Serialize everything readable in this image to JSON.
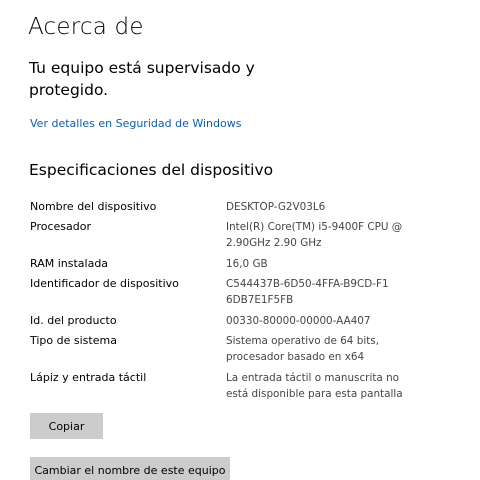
{
  "page": {
    "title": "Acerca de",
    "status": "Tu equipo está supervisado y protegido.",
    "security_link": "Ver detalles en Seguridad de Windows"
  },
  "specs": {
    "section_title": "Especificaciones del dispositivo",
    "rows": [
      {
        "label": "Nombre del dispositivo",
        "value": "DESKTOP-G2V03L6"
      },
      {
        "label": "Procesador",
        "value": "Intel(R) Core(TM) i5-9400F CPU @ 2.90GHz   2.90 GHz"
      },
      {
        "label": "RAM instalada",
        "value": "16,0 GB"
      },
      {
        "label": "Identificador de dispositivo",
        "value": "C544437B-6D50-4FFA-B9CD-F16DB7E1F5FB"
      },
      {
        "label": "Id. del producto",
        "value": "00330-80000-00000-AA407"
      },
      {
        "label": "Tipo de sistema",
        "value": "Sistema operativo de 64 bits, procesador basado en x64"
      },
      {
        "label": "Lápiz y entrada táctil",
        "value": "La entrada táctil o manuscrita no está disponible para esta pantalla"
      }
    ]
  },
  "buttons": {
    "copy": "Copiar",
    "rename": "Cambiar el nombre de este equipo"
  }
}
